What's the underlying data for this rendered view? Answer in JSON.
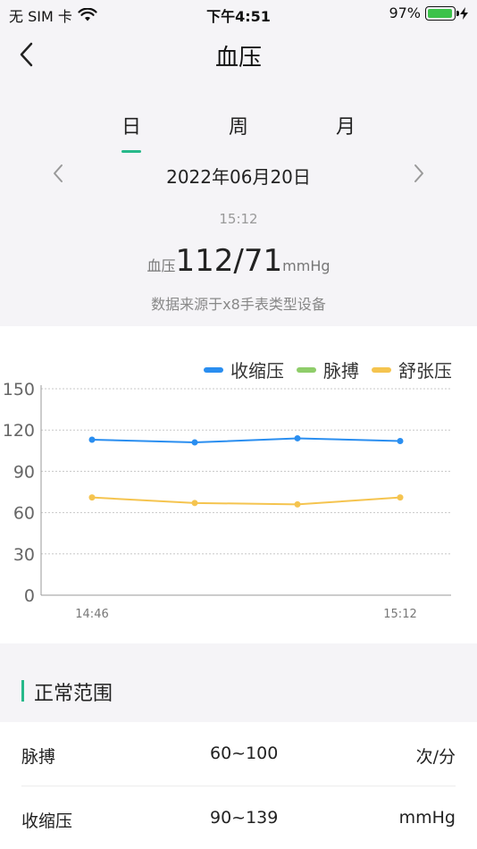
{
  "status_bar": {
    "carrier": "无 SIM 卡",
    "time": "下午4:51",
    "battery_percent": "97%",
    "battery_level": 0.97
  },
  "nav": {
    "title": "血压"
  },
  "tabs": [
    {
      "label": "日",
      "active": true
    },
    {
      "label": "周",
      "active": false
    },
    {
      "label": "月",
      "active": false
    }
  ],
  "date": {
    "text": "2022年06月20日"
  },
  "reading": {
    "time": "15:12",
    "label": "血压",
    "value": "112/71",
    "unit": "mmHg",
    "source": "数据来源于x8手表类型设备"
  },
  "chart_data": {
    "type": "line",
    "x": [
      "14:46",
      "",
      "",
      "15:12"
    ],
    "xticks": [
      "14:46",
      "15:12"
    ],
    "ylim": [
      0,
      150
    ],
    "yticks": [
      0,
      30,
      60,
      90,
      120,
      150
    ],
    "grid": true,
    "legend_position": "top-right",
    "series": [
      {
        "name": "收缩压",
        "color": "#2a8ef0",
        "values": [
          113,
          111,
          114,
          112
        ]
      },
      {
        "name": "脉搏",
        "color": "#8fcd6a",
        "values": []
      },
      {
        "name": "舒张压",
        "color": "#f5c44f",
        "values": [
          71,
          67,
          66,
          71
        ]
      }
    ]
  },
  "normal_range": {
    "title": "正常范围",
    "rows": [
      {
        "name": "脉搏",
        "range": "60~100",
        "unit": "次/分"
      },
      {
        "name": "收缩压",
        "range": "90~139",
        "unit": "mmHg"
      }
    ]
  }
}
